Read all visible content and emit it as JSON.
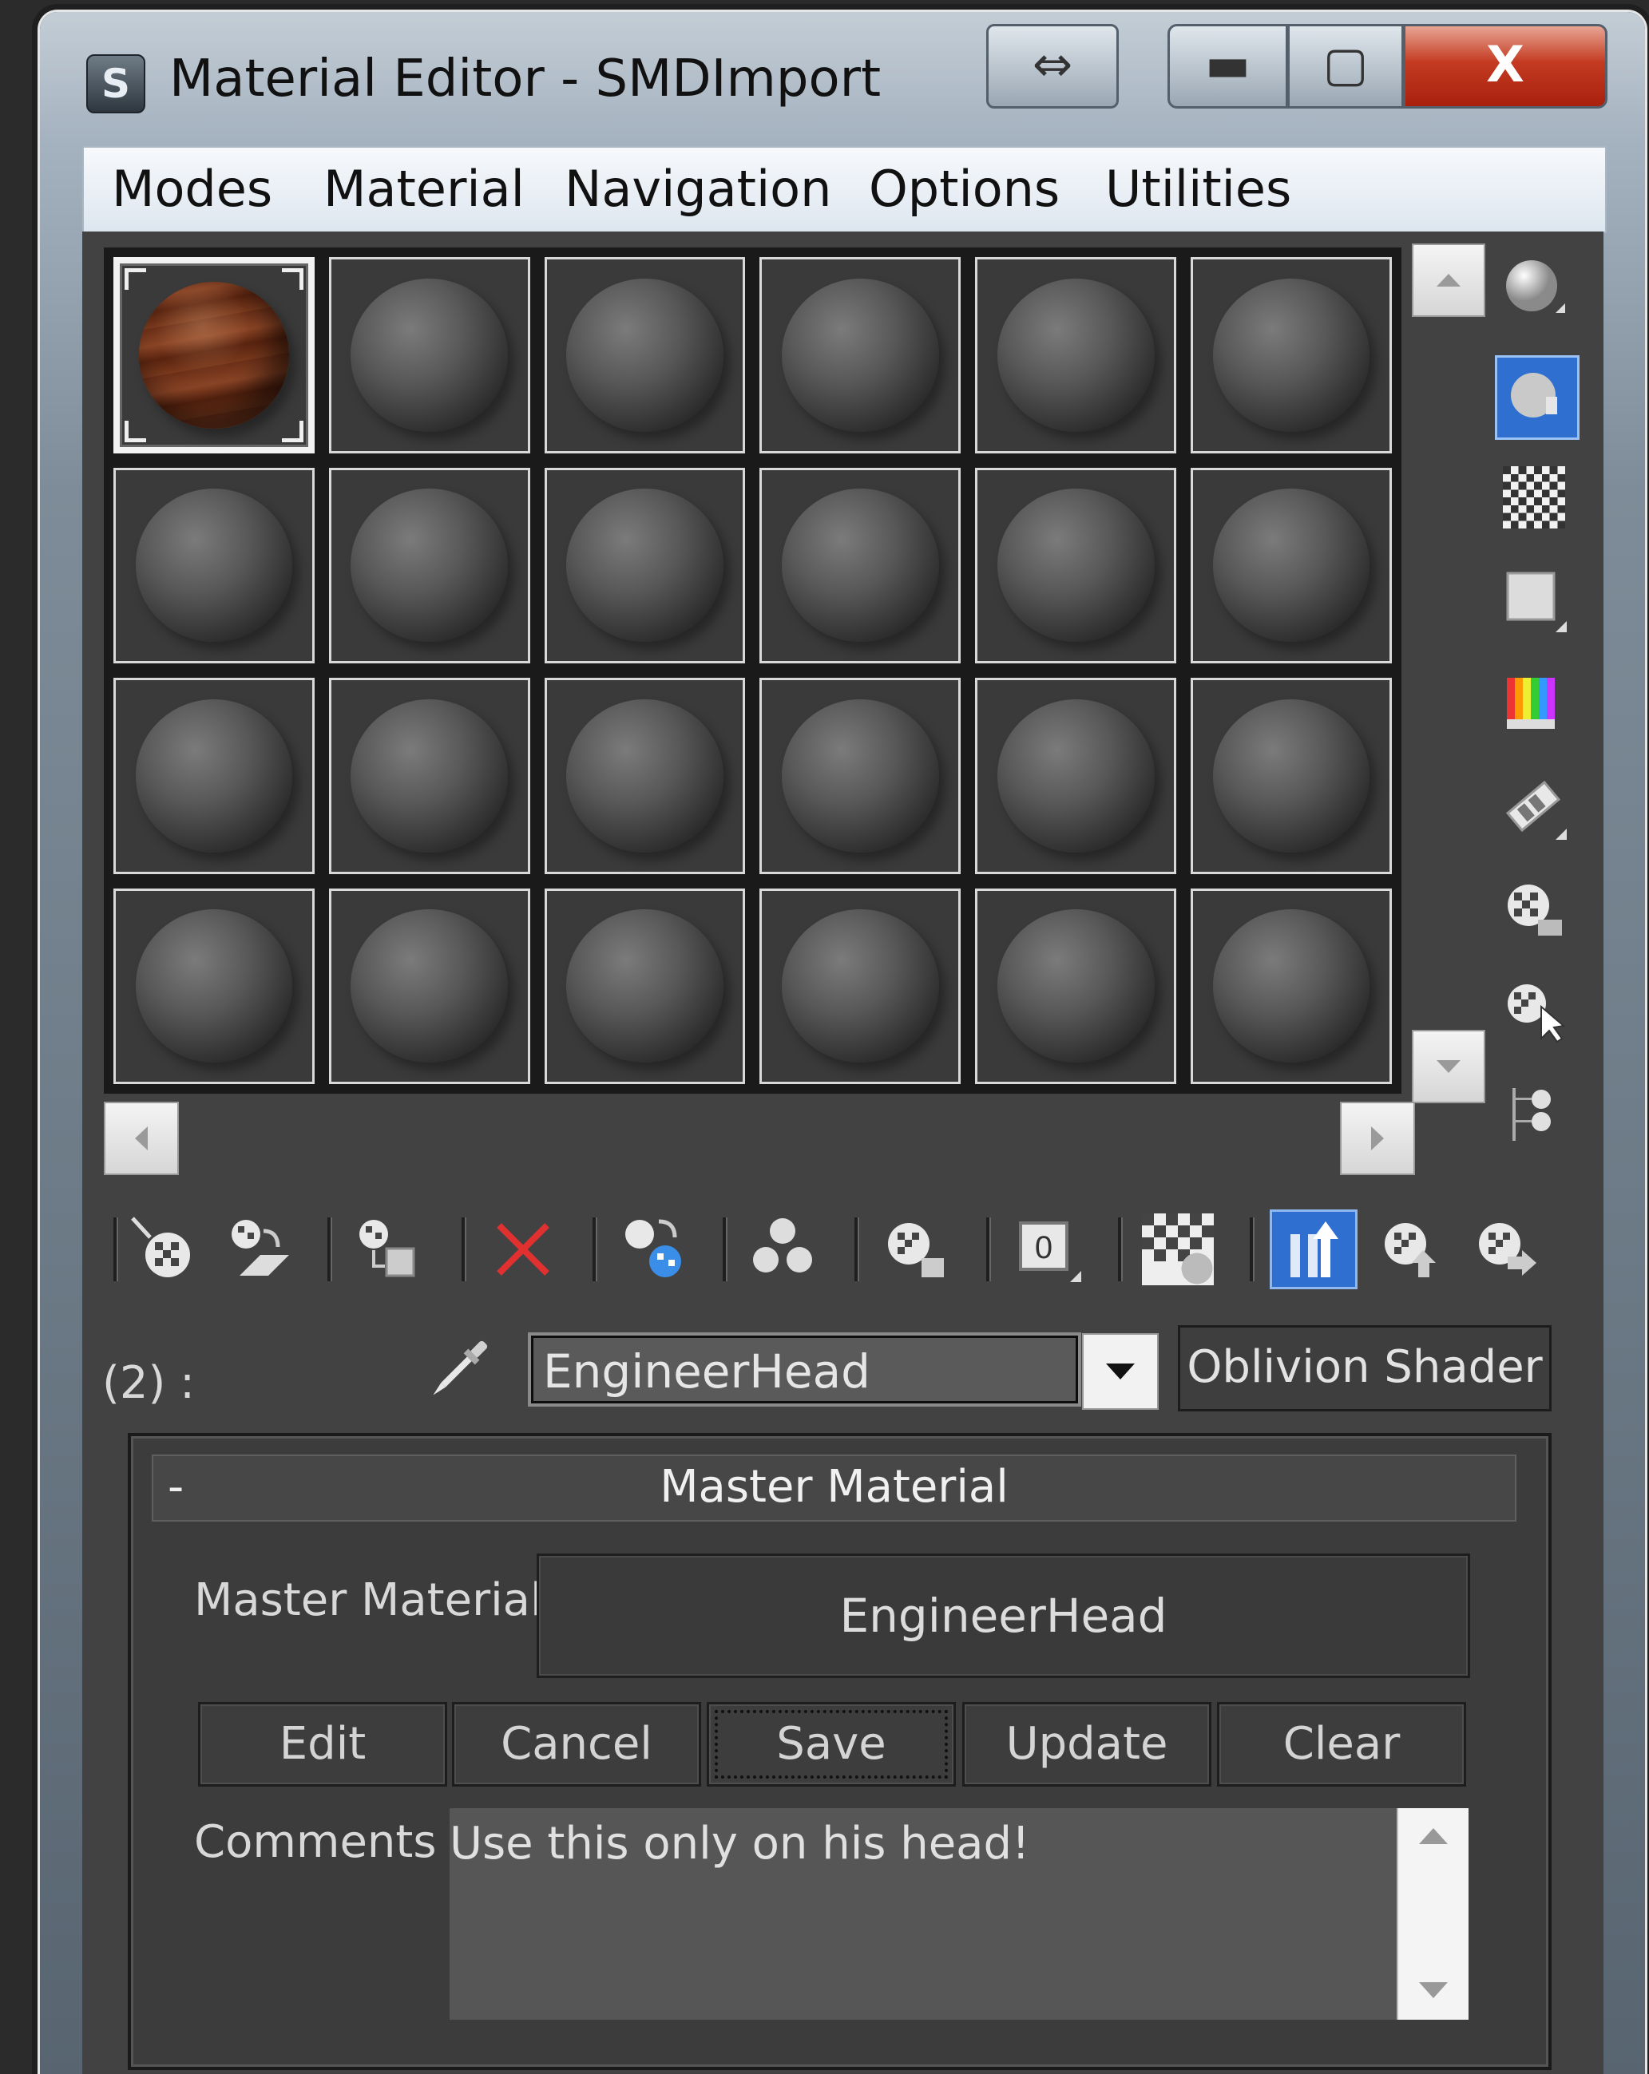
{
  "window": {
    "title": "Material Editor - SMDImport",
    "icon": "3ds-max-logo-icon",
    "icon_glyph": "S",
    "controls": {
      "arrows": "⇔",
      "minimize": "▬",
      "maximize": "▢",
      "close": "X"
    }
  },
  "menu": [
    "Modes",
    "Material",
    "Navigation",
    "Options",
    "Utilities"
  ],
  "sample_slots": {
    "rows": 4,
    "columns": 6,
    "active_index": 0,
    "active_slot_material": "head"
  },
  "side_toolbar": [
    "sample-type-sphere-icon",
    "backlight-icon",
    "background-checker-icon",
    "sample-uv-tiling-icon",
    "video-color-check-icon",
    "make-preview-icon",
    "options-icon",
    "select-by-material-icon",
    "material-map-navigator-icon"
  ],
  "bottom_toolbar": [
    "get-material-icon",
    "put-material-to-scene-icon",
    "assign-material-to-selection-icon",
    "reset-map-icon",
    "make-material-copy-icon",
    "make-unique-icon",
    "put-to-library-icon",
    "material-id-channel-icon",
    "show-shaded-material-in-viewport-icon",
    "show-end-result-icon",
    "go-to-parent-icon",
    "go-forward-to-sibling-icon"
  ],
  "slot_label": "(2) :",
  "material_name": "EngineerHead",
  "shader_button": "Oblivion Shader",
  "rollout": {
    "collapse_symbol": "-",
    "title": "Master Material",
    "master_label": "Master Material",
    "master_value": "EngineerHead",
    "buttons": [
      "Edit",
      "Cancel",
      "Save",
      "Update",
      "Clear"
    ],
    "focused_button": "Save",
    "comments_label": "Comments",
    "comments_text": "Use this only on his head!"
  }
}
